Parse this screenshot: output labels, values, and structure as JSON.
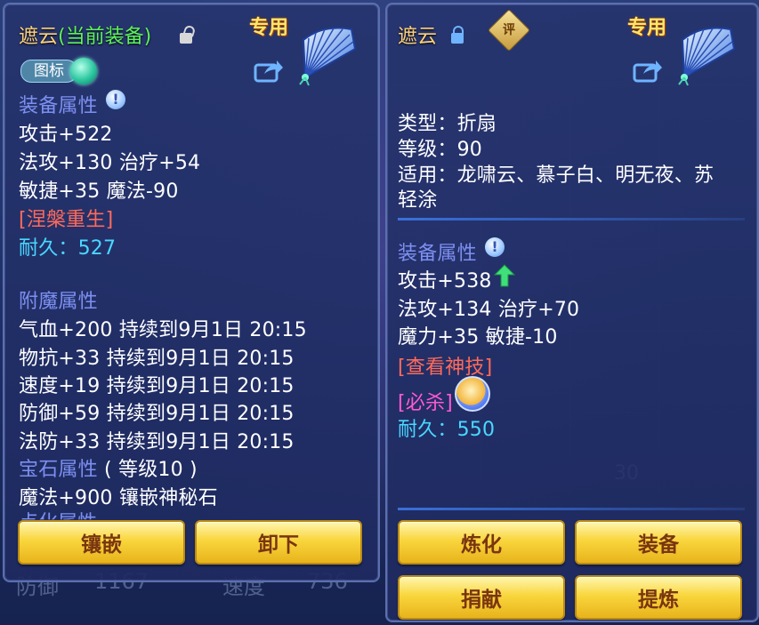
{
  "background": {
    "stat_left_label": "防御",
    "stat_left_value": "1167",
    "stat_right_label": "速度",
    "stat_right_value": "736"
  },
  "left_panel": {
    "title_name": "遮云",
    "title_status": "(当前装备)",
    "special_tag": "专用",
    "badge_label": "图标",
    "equip_attr_heading": "装备属性",
    "equip_attrs": [
      "攻击+522",
      "法攻+130 治疗+54",
      "敏捷+35 魔法-90"
    ],
    "nirvana": "[涅槃重生]",
    "durability": "耐久：527",
    "enchant_heading": "附魔属性",
    "enchants": [
      "气血+200 持续到9月1日 20:15",
      "物抗+33 持续到9月1日 20:15",
      "速度+19 持续到9月1日 20:15",
      "防御+59 持续到9月1日 20:15",
      "法防+33 持续到9月1日 20:15"
    ],
    "gem_heading": "宝石属性",
    "gem_level": "( 等级10 )",
    "gem_attr": "魔法+900 镶嵌神秘石",
    "cutoff_heading": "点化属性",
    "btn_inlay": "镶嵌",
    "btn_unequip": "卸下"
  },
  "right_panel": {
    "title_name": "遮云",
    "rate_badge": "评",
    "special_tag": "专用",
    "type_line": "类型：折扇",
    "level_line": "等级：90",
    "suit_line1": "适用：龙啸云、慕子白、明无夜、苏",
    "suit_line2": "轻涂",
    "equip_attr_heading": "装备属性",
    "attr_attack": "攻击+538",
    "attr_line2": "法攻+134 治疗+70",
    "attr_line3": "魔力+35 敏捷-10",
    "view_skill": "[查看神技]",
    "kill_skill": "[必杀]",
    "durability": "耐久：550",
    "bg_count": "30",
    "btn_refine": "炼化",
    "btn_equip": "装备",
    "btn_donate": "捐献",
    "btn_extract": "提炼"
  },
  "colors": {
    "title": "#ffd27a",
    "equipped": "#5df25a",
    "section": "#7d8ff0",
    "red_link": "#ff6a5a",
    "cyan": "#49d8ff",
    "pink": "#ff5ad2",
    "button": "#f9d63d"
  }
}
